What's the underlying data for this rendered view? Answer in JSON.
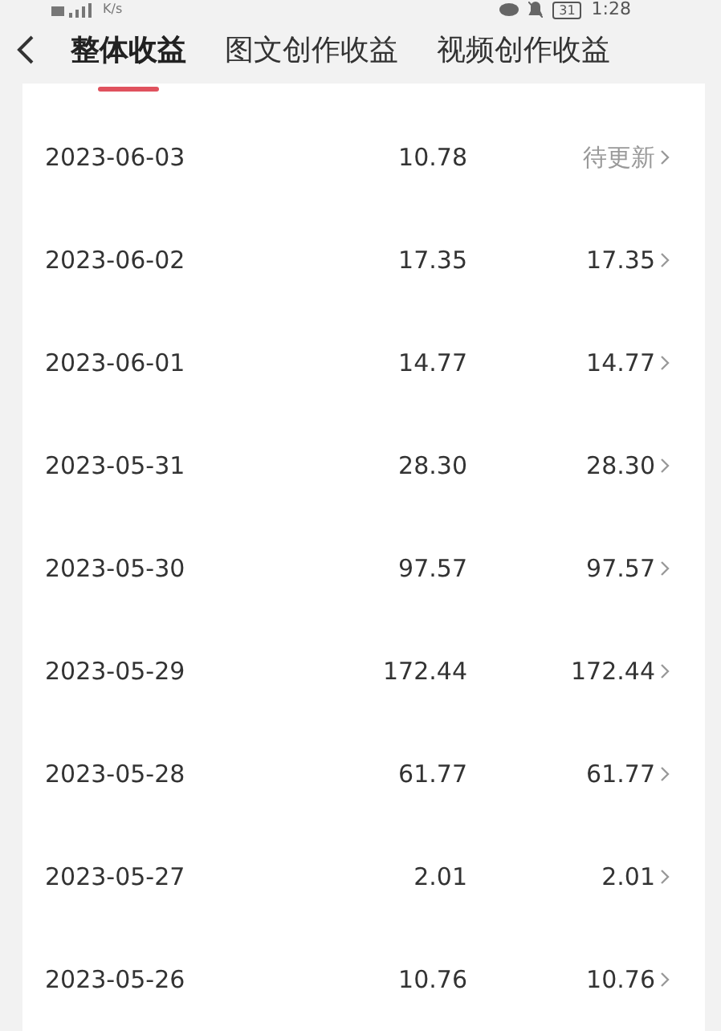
{
  "status_bar": {
    "speed_unit": "K/s",
    "battery": "31",
    "time": "1:28"
  },
  "tabs": [
    {
      "label": "整体收益",
      "selected": true
    },
    {
      "label": "图文创作收益",
      "selected": false
    },
    {
      "label": "视频创作收益",
      "selected": false
    }
  ],
  "rows": [
    {
      "date": "2023-06-03",
      "amount": "10.78",
      "settled": "待更新",
      "kind": "pending"
    },
    {
      "date": "2023-06-02",
      "amount": "17.35",
      "settled": "17.35",
      "kind": "value"
    },
    {
      "date": "2023-06-01",
      "amount": "14.77",
      "settled": "14.77",
      "kind": "value"
    },
    {
      "date": "2023-05-31",
      "amount": "28.30",
      "settled": "28.30",
      "kind": "value"
    },
    {
      "date": "2023-05-30",
      "amount": "97.57",
      "settled": "97.57",
      "kind": "value"
    },
    {
      "date": "2023-05-29",
      "amount": "172.44",
      "settled": "172.44",
      "kind": "value"
    },
    {
      "date": "2023-05-28",
      "amount": "61.77",
      "settled": "61.77",
      "kind": "value"
    },
    {
      "date": "2023-05-27",
      "amount": "2.01",
      "settled": "2.01",
      "kind": "value"
    },
    {
      "date": "2023-05-26",
      "amount": "10.76",
      "settled": "10.76",
      "kind": "value"
    }
  ]
}
